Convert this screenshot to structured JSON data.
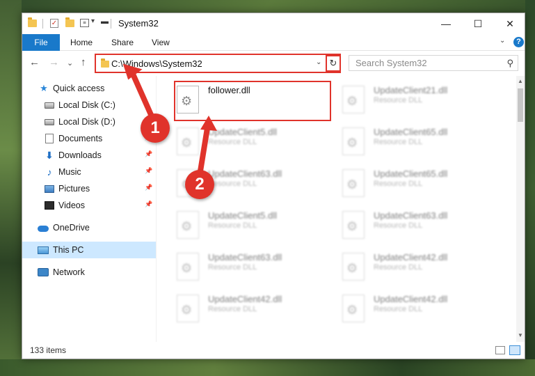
{
  "window": {
    "title": "System32",
    "minimize_glyph": "—",
    "maximize_glyph": "☐",
    "close_glyph": "✕",
    "qat_check_glyph": "✓",
    "qat_props_glyph": "≡",
    "qat_dropdown_glyph": "▾"
  },
  "ribbon": {
    "tabs": [
      "File",
      "Home",
      "Share",
      "View"
    ],
    "expand_glyph": "⌄",
    "help_glyph": "?",
    "accent": "#1979ca"
  },
  "nav": {
    "back_glyph": "←",
    "forward_glyph": "→",
    "recent_glyph": "⌄",
    "up_glyph": "↑",
    "address": "C:\\Windows\\System32",
    "address_dropdown_glyph": "⌄",
    "refresh_glyph": "↻",
    "search_placeholder": "Search System32",
    "search_glyph": "⚲"
  },
  "sidebar": {
    "items": [
      {
        "label": "Quick access",
        "icon": "star-icon",
        "glyph": "★",
        "pinned": false
      },
      {
        "label": "Local Disk (C:)",
        "icon": "disk-icon",
        "glyph": "",
        "pinned": false
      },
      {
        "label": "Local Disk (D:)",
        "icon": "disk-icon",
        "glyph": "",
        "pinned": false
      },
      {
        "label": "Documents",
        "icon": "documents-icon",
        "glyph": "",
        "pinned": true
      },
      {
        "label": "Downloads",
        "icon": "download-icon",
        "glyph": "⬇",
        "pinned": true
      },
      {
        "label": "Music",
        "icon": "music-icon",
        "glyph": "♪",
        "pinned": true
      },
      {
        "label": "Pictures",
        "icon": "pictures-icon",
        "glyph": "",
        "pinned": true
      },
      {
        "label": "Videos",
        "icon": "videos-icon",
        "glyph": "",
        "pinned": true
      },
      {
        "label": "OneDrive",
        "icon": "onedrive-icon",
        "glyph": "",
        "pinned": false
      },
      {
        "label": "This PC",
        "icon": "this-pc-icon",
        "glyph": "",
        "pinned": false,
        "selected": true
      },
      {
        "label": "Network",
        "icon": "network-icon",
        "glyph": "",
        "pinned": false
      }
    ],
    "pin_glyph": "📌"
  },
  "files": {
    "highlighted": {
      "name": "follower.dll",
      "type": ""
    },
    "blurred_left": [
      {
        "name": "UpdateClient5.dll",
        "type": "Resource DLL"
      },
      {
        "name": "UpdateClient63.dll",
        "type": "Resource DLL"
      },
      {
        "name": "UpdateClient5.dll",
        "type": "Resource DLL"
      },
      {
        "name": "UpdateClient63.dll",
        "type": "Resource DLL"
      },
      {
        "name": "UpdateClient42.dll",
        "type": "Resource DLL"
      }
    ],
    "blurred_right": [
      {
        "name": "UpdateClient21.dll",
        "type": "Resource DLL"
      },
      {
        "name": "UpdateClient65.dll",
        "type": "Resource DLL"
      },
      {
        "name": "UpdateClient65.dll",
        "type": "Resource DLL"
      },
      {
        "name": "UpdateClient63.dll",
        "type": "Resource DLL"
      },
      {
        "name": "UpdateClient42.dll",
        "type": "Resource DLL"
      },
      {
        "name": "UpdateClient42.dll",
        "type": "Resource DLL"
      }
    ]
  },
  "status": {
    "item_count": "133 items"
  },
  "callouts": {
    "one": "1",
    "two": "2",
    "color": "#e0332b"
  }
}
